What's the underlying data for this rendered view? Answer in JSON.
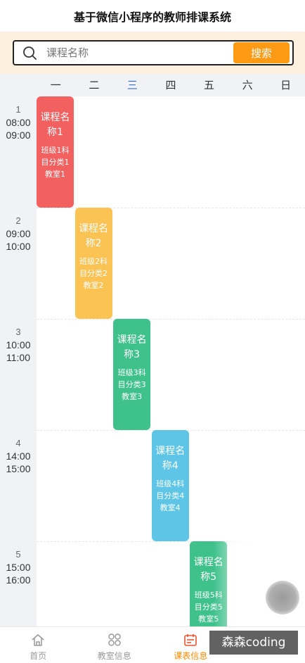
{
  "header": {
    "title": "基于微信小程序的教师排课系统"
  },
  "search": {
    "placeholder": "课程名称",
    "value": "",
    "button_label": "搜索",
    "button_color": "#ff9a14"
  },
  "week_days": [
    {
      "label": "一",
      "today": false
    },
    {
      "label": "二",
      "today": false
    },
    {
      "label": "三",
      "today": true
    },
    {
      "label": "四",
      "today": false
    },
    {
      "label": "五",
      "today": false
    },
    {
      "label": "六",
      "today": false
    },
    {
      "label": "日",
      "today": false
    }
  ],
  "time_slots": [
    {
      "index": "1",
      "start": "08:00",
      "end": "09:00"
    },
    {
      "index": "2",
      "start": "09:00",
      "end": "10:00"
    },
    {
      "index": "3",
      "start": "10:00",
      "end": "11:00"
    },
    {
      "index": "4",
      "start": "14:00",
      "end": "15:00"
    },
    {
      "index": "5",
      "start": "15:00",
      "end": "16:00"
    }
  ],
  "courses": [
    {
      "day": 0,
      "slot": 0,
      "name": "课程名称1",
      "info": "班级1科目分类1教室1",
      "color": "#f2605f"
    },
    {
      "day": 1,
      "slot": 1,
      "name": "课程名称2",
      "info": "班级2科目分类2教室2",
      "color": "#fbc254"
    },
    {
      "day": 2,
      "slot": 2,
      "name": "课程名称3",
      "info": "班级3科目分类3教室3",
      "color": "#3fc18c"
    },
    {
      "day": 3,
      "slot": 3,
      "name": "课程名称4",
      "info": "班级4科目分类4教室4",
      "color": "#5ec5e6"
    },
    {
      "day": 4,
      "slot": 4,
      "name": "课程名称5",
      "info": "班级5科目分类5教室5",
      "color": "#3fc18c"
    }
  ],
  "tabbar": {
    "items": [
      {
        "label": "首页",
        "icon": "home-icon",
        "active": false
      },
      {
        "label": "教室信息",
        "icon": "grid-icon",
        "active": false
      },
      {
        "label": "课表信息",
        "icon": "calendar-icon",
        "active": true
      },
      {
        "label": "",
        "icon": "",
        "active": false
      }
    ],
    "active_color": "#ff8a00"
  },
  "watermark": "森森coding"
}
